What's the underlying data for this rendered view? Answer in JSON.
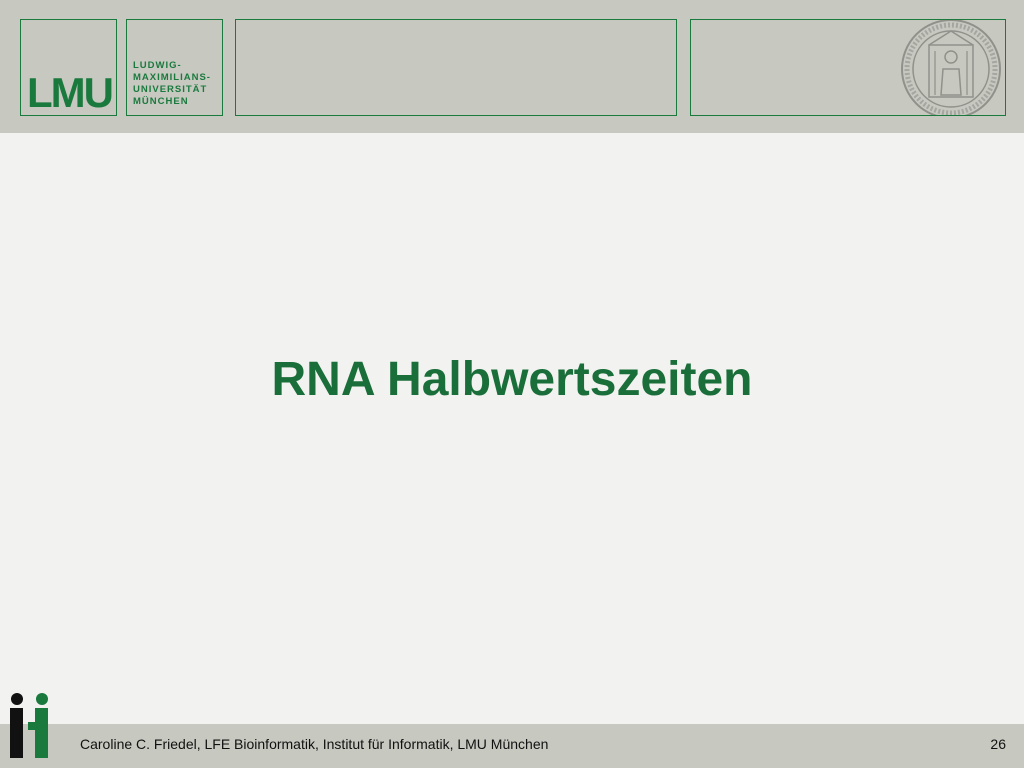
{
  "header": {
    "logo_text": "LMU",
    "university_lines": [
      "LUDWIG-",
      "MAXIMILIANS-",
      "UNIVERSITÄT",
      "MÜNCHEN"
    ]
  },
  "slide": {
    "title": "RNA Halbwertszeiten"
  },
  "footer": {
    "text": "Caroline C. Friedel, LFE Bioinformatik, Institut für Informatik, LMU München",
    "page_number": "26"
  },
  "colors": {
    "brand_green": "#1a7a3e",
    "header_gray": "#c7c8c0",
    "background": "#f2f2f0"
  },
  "icons": {
    "seal": "university-seal-icon",
    "ifi": "ifi-logo-icon"
  }
}
